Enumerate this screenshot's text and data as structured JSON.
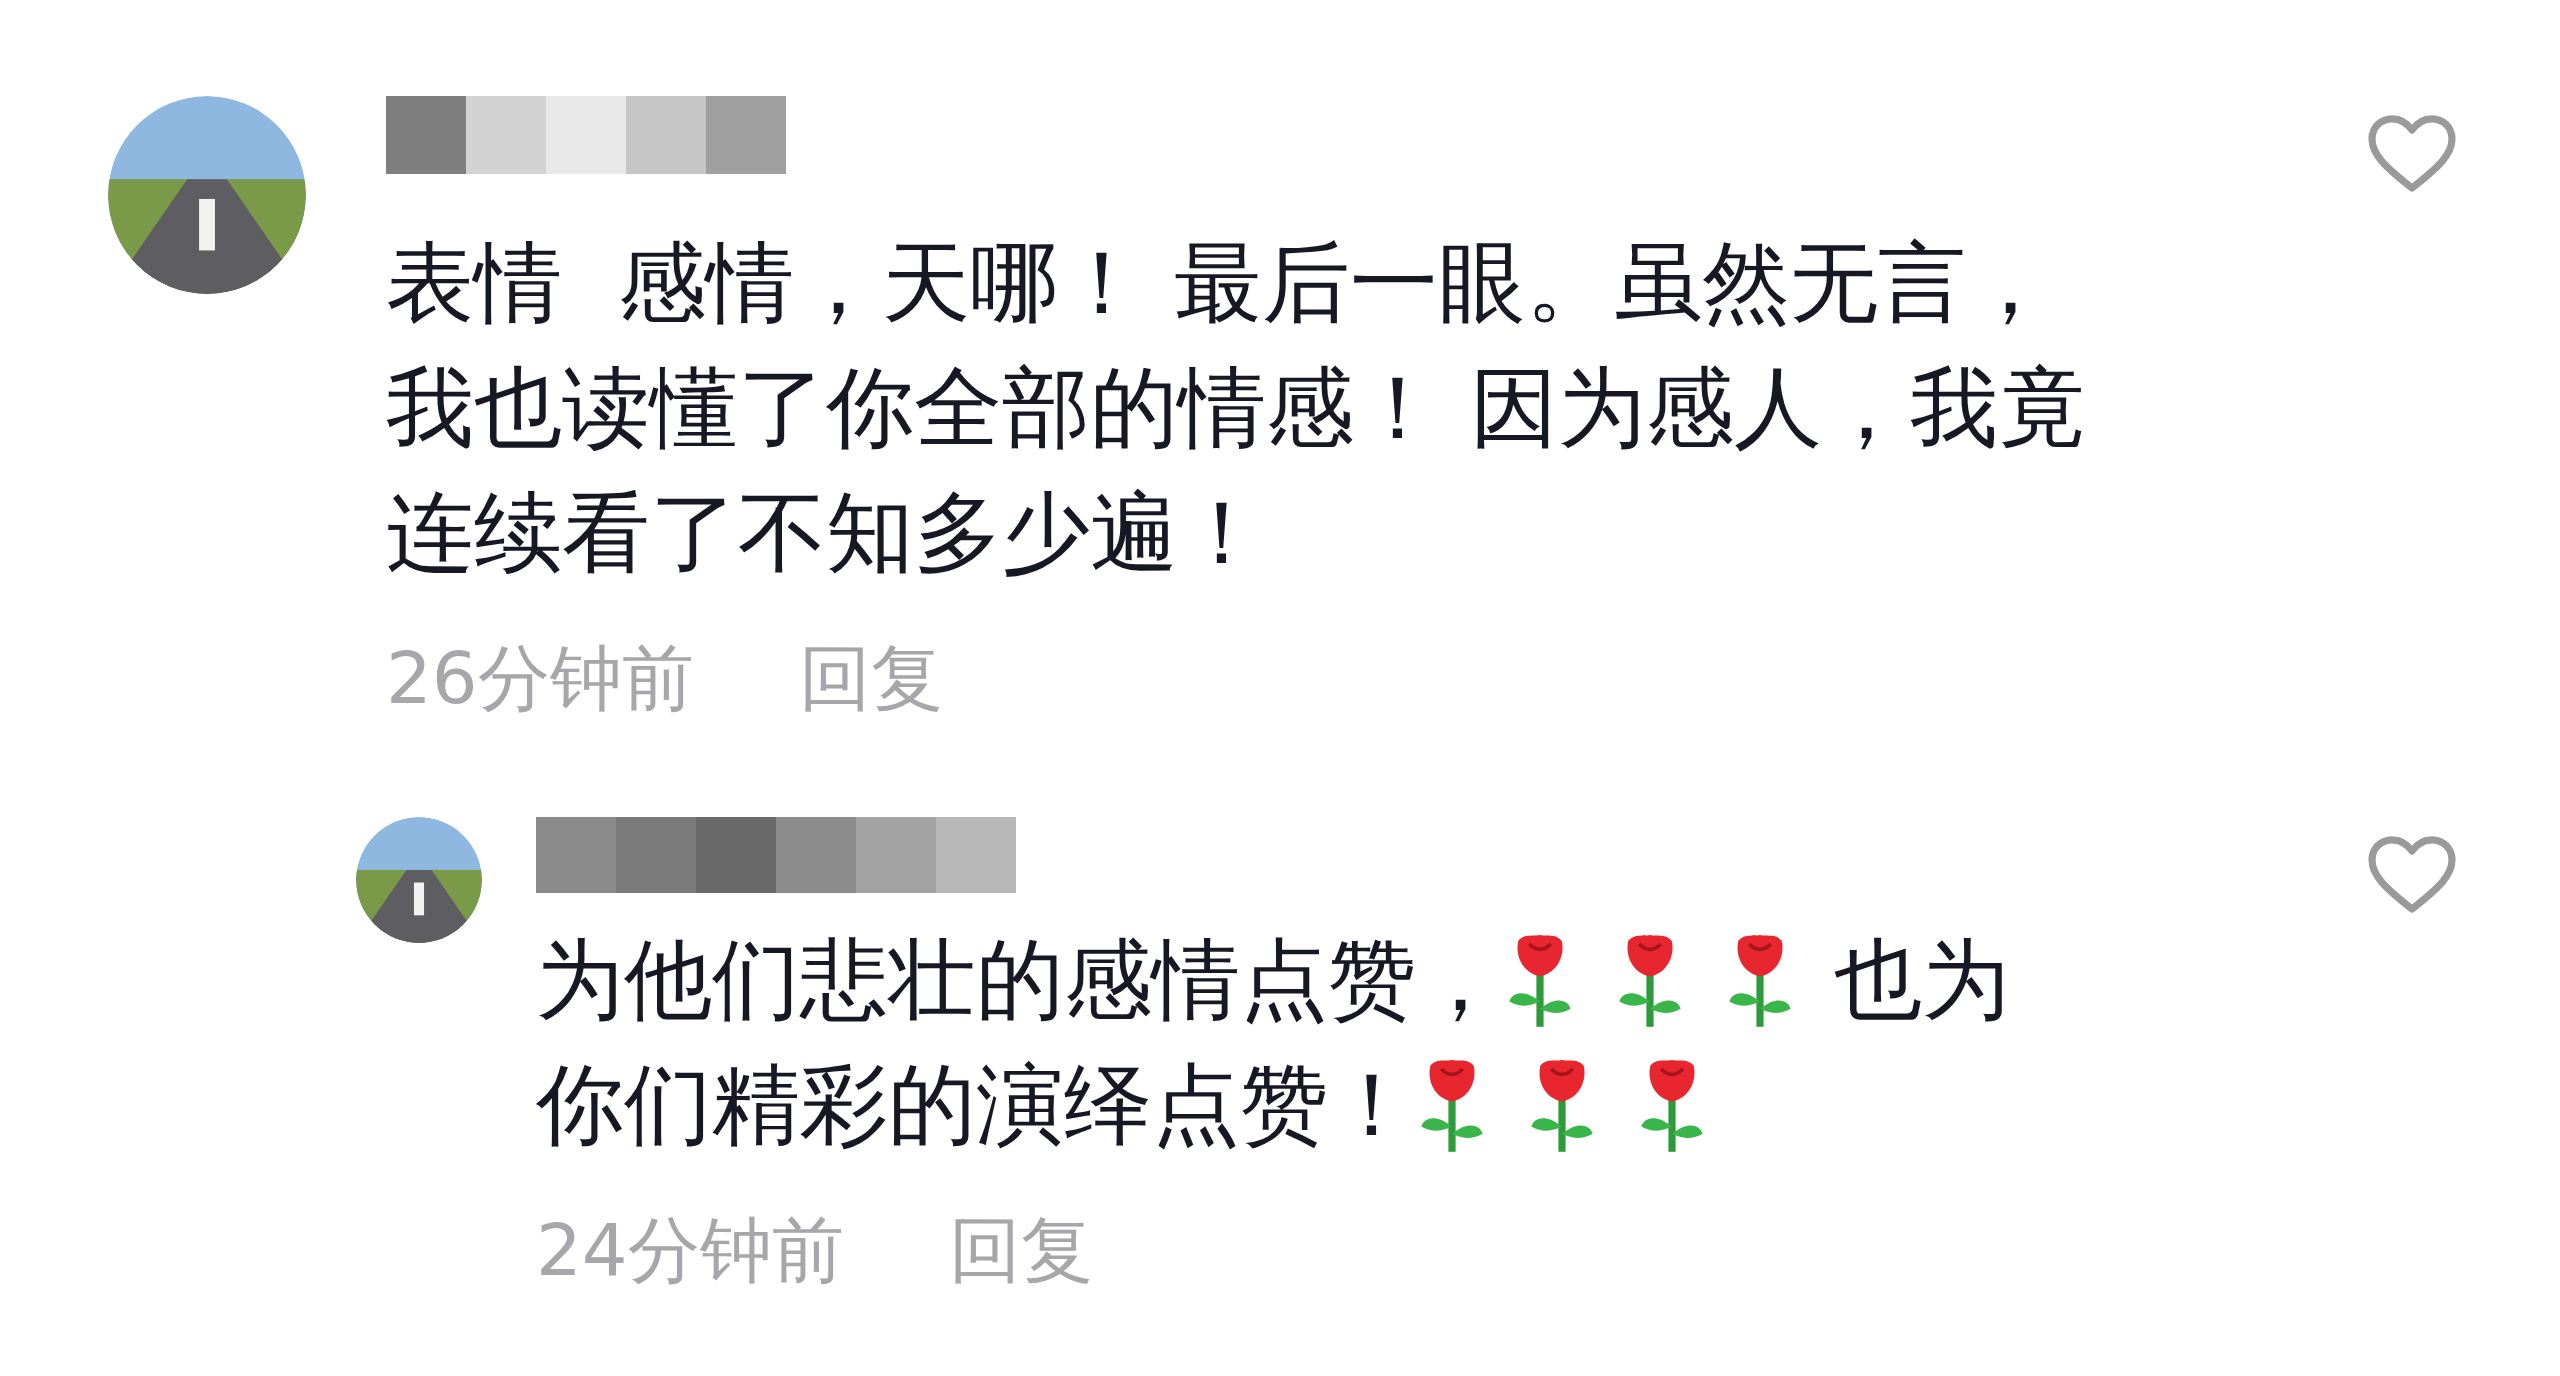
{
  "comments": [
    {
      "text": "表情  感情，天哪！ 最后一眼。虽然无言，我也读懂了你全部的情感！ 因为感人，我竟连续看了不知多少遍！",
      "time": "26分钟前",
      "reply_label": "回复",
      "liked": false,
      "replies": [
        {
          "segments": [
            {
              "kind": "text",
              "text": "为他们悲壮的感情点赞，"
            },
            {
              "kind": "rose"
            },
            {
              "kind": "rose"
            },
            {
              "kind": "rose"
            },
            {
              "kind": "text",
              "text": "也为你们精彩的演绎点赞！"
            },
            {
              "kind": "rose"
            },
            {
              "kind": "rose"
            },
            {
              "kind": "rose"
            }
          ],
          "time": "24分钟前",
          "reply_label": "回复",
          "liked": false
        }
      ]
    }
  ]
}
